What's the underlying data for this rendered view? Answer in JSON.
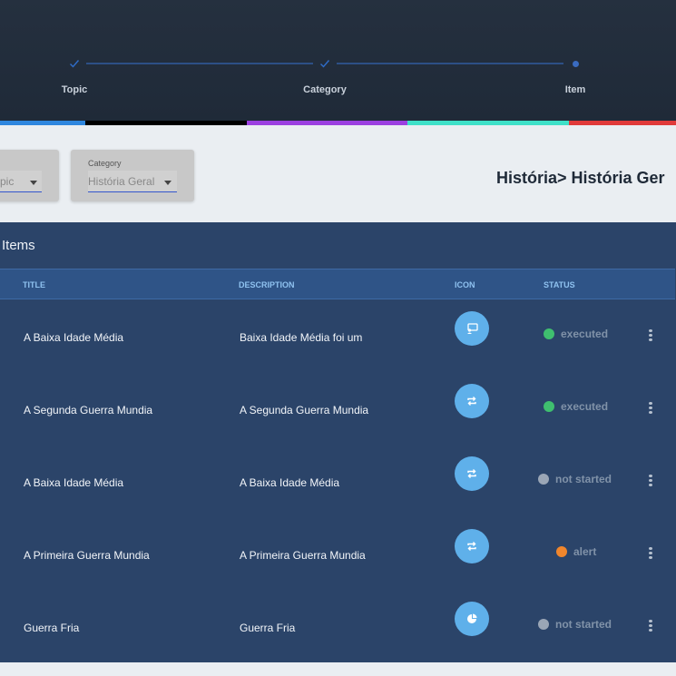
{
  "stepper": {
    "steps": [
      {
        "label": "Topic",
        "state": "done"
      },
      {
        "label": "Category",
        "state": "done"
      },
      {
        "label": "Item",
        "state": "current"
      }
    ]
  },
  "color_bar": [
    "#2e86de",
    "#000000",
    "#9b3fe0",
    "#3ee0c8",
    "#e03a3a"
  ],
  "filters": {
    "topic": {
      "value_fragment": "pic"
    },
    "category": {
      "label": "Category",
      "value": "História Geral"
    }
  },
  "breadcrumb": "História> História Ger",
  "panel": {
    "title": "Items",
    "columns": {
      "title": "TITLE",
      "description": "DESCRIPTION",
      "icon": "ICON",
      "status": "STATUS"
    }
  },
  "rows": [
    {
      "title": "A Baixa Idade Média",
      "description": "Baixa Idade Média foi um",
      "icon": "chalkboard-icon",
      "status": "executed",
      "status_color": "#3fbf6f"
    },
    {
      "title": "A Segunda Guerra Mundia",
      "description": "A Segunda Guerra Mundia",
      "icon": "repeat-icon",
      "status": "executed",
      "status_color": "#3fbf6f"
    },
    {
      "title": "A Baixa Idade Média",
      "description": "A Baixa Idade Média",
      "icon": "repeat-icon",
      "status": "not started",
      "status_color": "#9aa6b6"
    },
    {
      "title": "A Primeira Guerra Mundia",
      "description": "A Primeira Guerra Mundia",
      "icon": "repeat-icon",
      "status": "alert",
      "status_color": "#f0862c"
    },
    {
      "title": "Guerra Fria",
      "description": "Guerra Fria",
      "icon": "pie-chart-icon",
      "status": "not started",
      "status_color": "#9aa6b6"
    }
  ]
}
